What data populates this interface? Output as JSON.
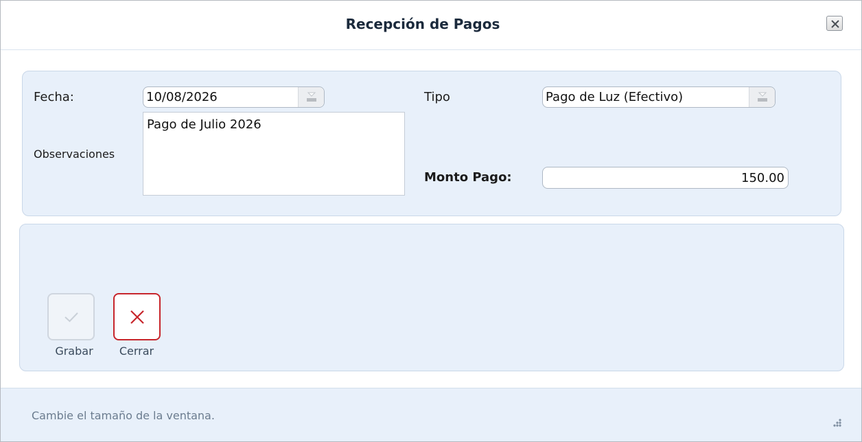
{
  "window": {
    "title": "Recepción de Pagos",
    "close_icon": "close-x-icon"
  },
  "form": {
    "fecha_label": "Fecha:",
    "fecha_value": "10/08/2026",
    "tipo_label": "Tipo",
    "tipo_value": "Pago de Luz (Efectivo)",
    "observaciones_label": "Observaciones",
    "observaciones_value": "Pago de Julio 2026",
    "monto_label": "Monto Pago:",
    "monto_value": "150.00"
  },
  "actions": {
    "save_label": "Grabar",
    "save_icon": "checkmark-icon",
    "close_label": "Cerrar",
    "close_icon": "x-icon"
  },
  "footer": {
    "hint": "Cambie el tamaño de la ventana."
  },
  "colors": {
    "panel_bg": "#e8f0fa",
    "accent_red": "#c7252b",
    "title_color": "#1b2a3c"
  }
}
